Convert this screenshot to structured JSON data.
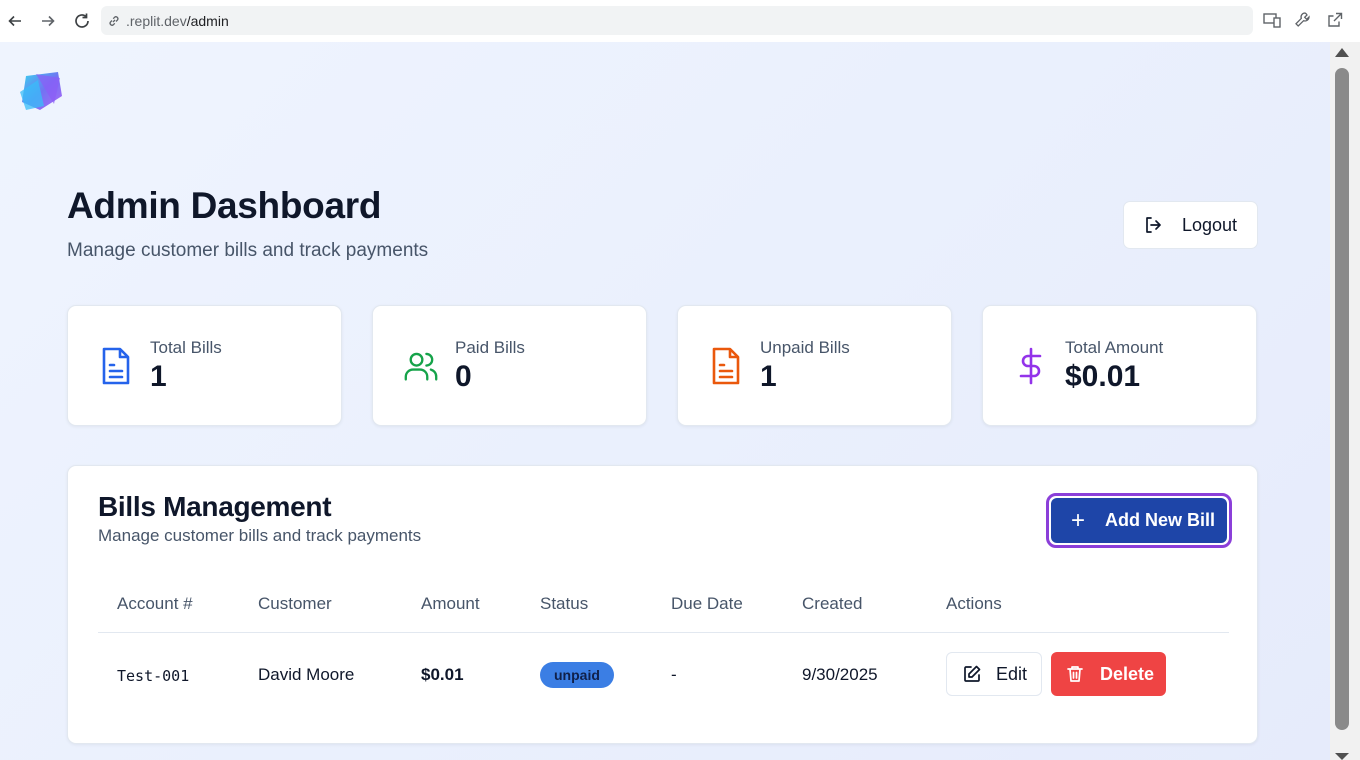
{
  "browser": {
    "url_domain": ".replit.dev",
    "url_path": "/admin"
  },
  "header": {
    "title": "Admin Dashboard",
    "subtitle": "Manage customer bills and track payments",
    "logout_label": "Logout"
  },
  "stats": [
    {
      "label": "Total Bills",
      "value": "1",
      "icon": "file-text-icon",
      "color": "#2563eb"
    },
    {
      "label": "Paid Bills",
      "value": "0",
      "icon": "users-icon",
      "color": "#16a34a"
    },
    {
      "label": "Unpaid Bills",
      "value": "1",
      "icon": "file-text-icon",
      "color": "#ea580c"
    },
    {
      "label": "Total Amount",
      "value": "$0.01",
      "icon": "dollar-sign-icon",
      "color": "#9333ea"
    }
  ],
  "bills": {
    "title": "Bills Management",
    "subtitle": "Manage customer bills and track payments",
    "add_label": "Add New Bill",
    "columns": [
      "Account #",
      "Customer",
      "Amount",
      "Status",
      "Due Date",
      "Created",
      "Actions"
    ],
    "rows": [
      {
        "account": "Test-001",
        "customer": "David Moore",
        "amount": "$0.01",
        "status": "unpaid",
        "due_date": "-",
        "created": "9/30/2025",
        "edit_label": "Edit",
        "delete_label": "Delete"
      }
    ]
  },
  "colors": {
    "primary": "#1e45a8",
    "focus_ring": "#8b3fd9",
    "danger": "#ef4444",
    "status_unpaid": "#3b7ee4"
  }
}
